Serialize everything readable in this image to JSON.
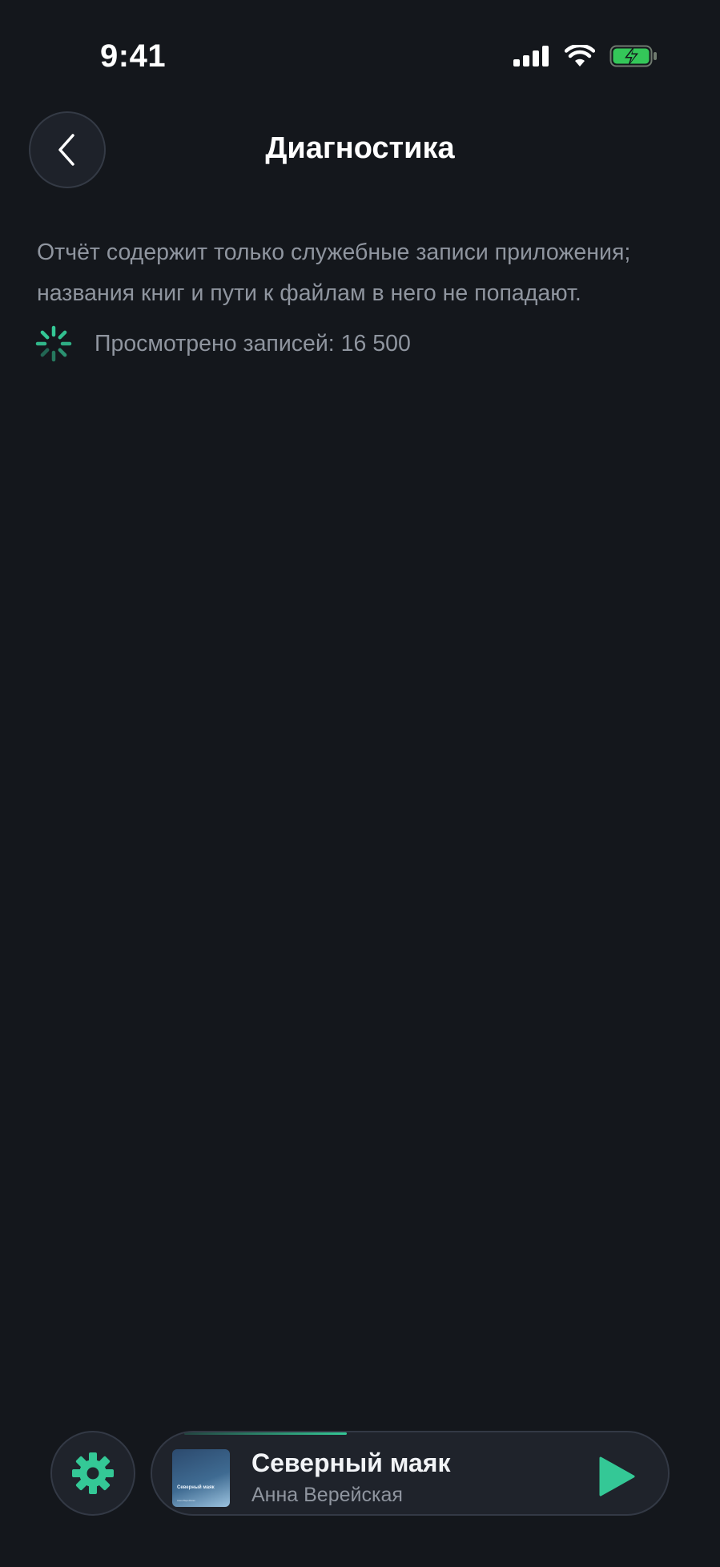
{
  "status_bar": {
    "time": "9:41"
  },
  "header": {
    "title": "Диагностика"
  },
  "content": {
    "description": "Отчёт содержит только служебные записи приложения; названия книг и пути к файлам в него не попадают.",
    "progress_label": "Просмотрено записей:",
    "progress_count": "16 500"
  },
  "mini_player": {
    "title": "Северный маяк",
    "author": "Анна Верейская",
    "cover_title": "Северный маяк",
    "cover_subtitle": "Анна Верейская",
    "progress": 0.36
  },
  "colors": {
    "background": "#14171c",
    "accent": "#34c896",
    "text_secondary": "#8f959f"
  },
  "icons": {
    "back": "chevron-left-icon",
    "settings": "gear-icon",
    "play": "play-icon",
    "spinner": "loading-spinner-icon"
  }
}
